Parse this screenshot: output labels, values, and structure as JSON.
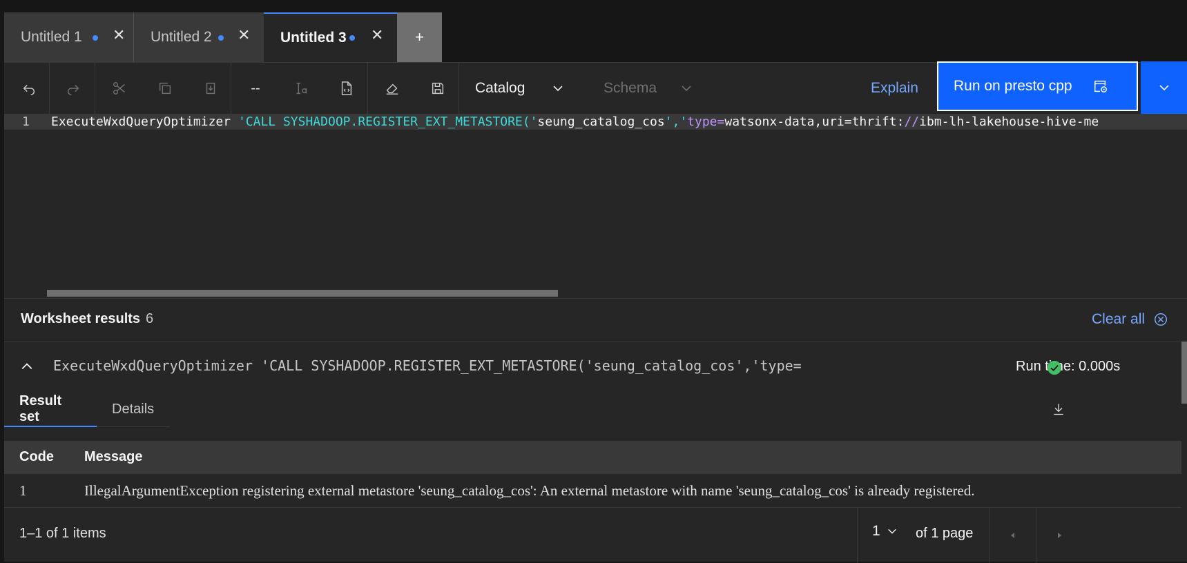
{
  "tabs": [
    {
      "label": "Untitled 1",
      "close": "✕"
    },
    {
      "label": "Untitled 2",
      "close": "✕"
    },
    {
      "label": "Untitled 3",
      "close": "✕"
    }
  ],
  "add_tab": "+",
  "toolbar": {
    "comment": "--",
    "catalog": "Catalog",
    "schema": "Schema",
    "explain": "Explain",
    "run": "Run on presto cpp"
  },
  "editor": {
    "line_number": "1",
    "code_segments": [
      "ExecuteWxdQueryOptimizer ",
      "'CALL SYSHADOOP.REGISTER_EXT_METASTORE('",
      "seung_catalog_cos",
      "','",
      "type=",
      "watsonx-data,uri=thrift:",
      "//",
      "ibm-lh-lakehouse-hive-me"
    ]
  },
  "results": {
    "title": "Worksheet results",
    "count": "6",
    "clear_all": "Clear all",
    "query": "ExecuteWxdQueryOptimizer 'CALL SYSHADOOP.REGISTER_EXT_METASTORE('seung_catalog_cos','type=",
    "run_time": "Run time: 0.000s",
    "tab_result_set": "Result set",
    "tab_details": "Details",
    "columns": [
      "Code",
      "Message"
    ],
    "rows": [
      {
        "code": "1",
        "message": "IllegalArgumentException registering external metastore 'seung_catalog_cos': An external metastore with name 'seung_catalog_cos' is already registered."
      }
    ],
    "pagination": {
      "items": "1–1 of 1 items",
      "page": "1",
      "of_pages": "of 1 page"
    }
  },
  "colors": {
    "accent": "#0f62fe",
    "link": "#78a9ff",
    "success": "#42be65",
    "string": "#3ddbd9",
    "keyword": "#be95ff"
  }
}
